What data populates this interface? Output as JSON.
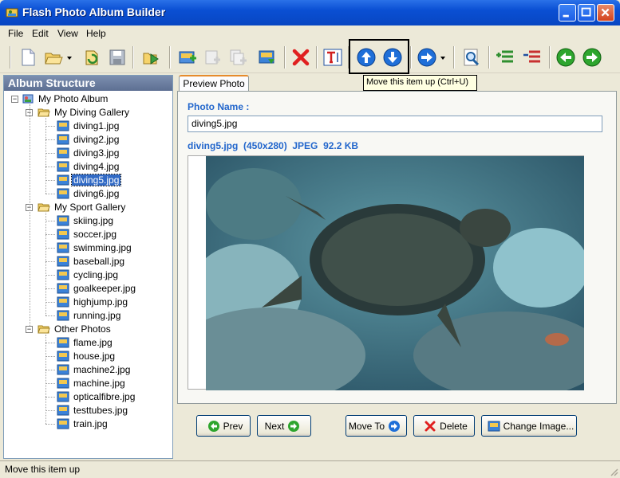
{
  "window": {
    "title": "Flash Photo Album Builder"
  },
  "menu": [
    "File",
    "Edit",
    "View",
    "Help"
  ],
  "tooltip": "Move this item up (Ctrl+U)",
  "tree": {
    "header": "Album Structure",
    "root": "My Photo Album",
    "galleries": [
      {
        "name": "My Diving Gallery",
        "items": [
          "diving1.jpg",
          "diving2.jpg",
          "diving3.jpg",
          "diving4.jpg",
          "diving5.jpg",
          "diving6.jpg"
        ]
      },
      {
        "name": "My Sport Gallery",
        "items": [
          "skiing.jpg",
          "soccer.jpg",
          "swimming.jpg",
          "baseball.jpg",
          "cycling.jpg",
          "goalkeeper.jpg",
          "highjump.jpg",
          "running.jpg"
        ]
      },
      {
        "name": "Other Photos",
        "items": [
          "flame.jpg",
          "house.jpg",
          "machine2.jpg",
          "machine.jpg",
          "opticalfibre.jpg",
          "testtubes.jpg",
          "train.jpg"
        ]
      }
    ],
    "selected": "diving5.jpg"
  },
  "preview": {
    "tab": "Preview Photo",
    "name_label": "Photo Name :",
    "name_value": "diving5.jpg",
    "info": "diving5.jpg  (450x280)  JPEG  92.2 KB"
  },
  "buttons": {
    "prev": "Prev",
    "next": "Next",
    "move_to": "Move To",
    "delete": "Delete",
    "change_image": "Change Image..."
  },
  "status": "Move this item up",
  "colors": {
    "accent": "#2266cc",
    "title_bar": "#0a4fd3",
    "selection": "#316ac5"
  }
}
